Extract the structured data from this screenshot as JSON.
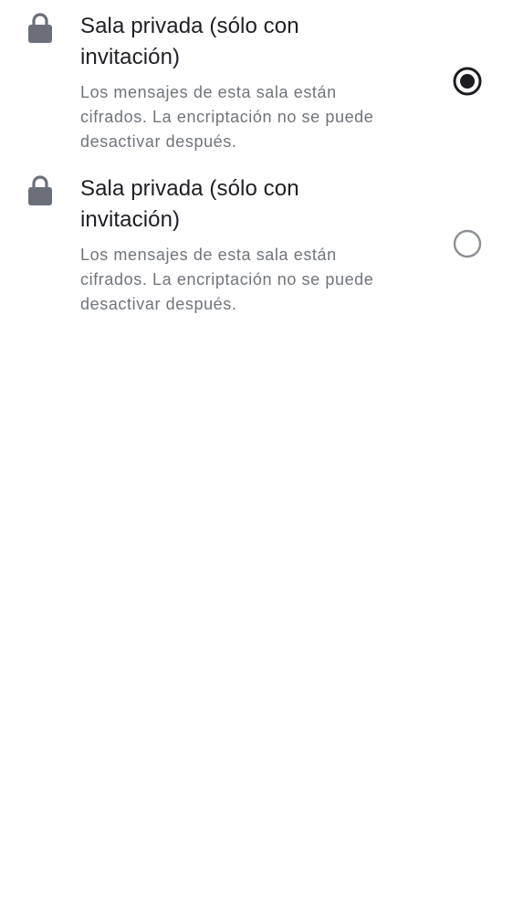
{
  "options": [
    {
      "icon": "lock-icon",
      "title": "Sala privada (sólo con invitación)",
      "description": "Los mensajes de esta sala están cifrados. La encriptación no se puede desactivar después.",
      "selected": true
    },
    {
      "icon": "lock-icon",
      "title": "Sala privada (sólo con invitación)",
      "description": "Los mensajes de esta sala están cifrados. La encriptación no se puede desactivar después.",
      "selected": false
    }
  ],
  "colors": {
    "title": "#1d1f24",
    "description": "#6f747c",
    "icon": "#6b6f78",
    "radio_selected": "#1b1d21",
    "radio_unselected": "#8a8f97"
  }
}
